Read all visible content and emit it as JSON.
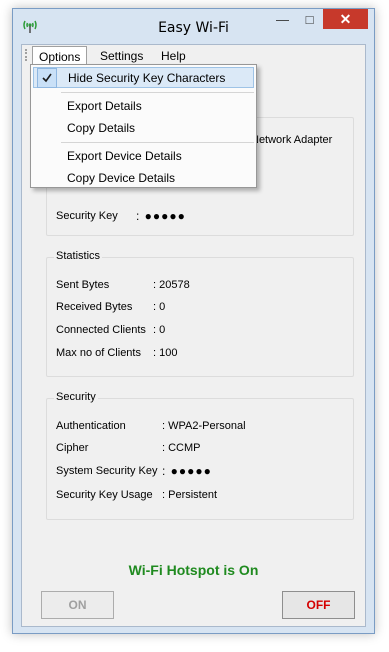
{
  "window": {
    "title": "Easy Wi-Fi"
  },
  "menubar": {
    "items": [
      "Options",
      "Settings",
      "Help"
    ]
  },
  "options_menu": {
    "items": [
      {
        "label": "Hide Security Key Characters",
        "checked": true
      },
      {
        "label": "Export Details"
      },
      {
        "label": "Copy Details"
      },
      {
        "label": "Export Device Details"
      },
      {
        "label": "Copy Device Details"
      }
    ]
  },
  "network": {
    "adapter_partial": "Network Adapter",
    "security_key_label": "Security Key",
    "security_key_value": ": ●●●●●"
  },
  "statistics": {
    "title": "Statistics",
    "rows": [
      {
        "label": "Sent Bytes",
        "value": ": 20578"
      },
      {
        "label": "Received Bytes",
        "value": ": 0"
      },
      {
        "label": "Connected Clients",
        "value": ": 0"
      },
      {
        "label": "Max no of Clients",
        "value": ": 100"
      }
    ]
  },
  "security": {
    "title": "Security",
    "rows": [
      {
        "label": "Authentication",
        "value": ": WPA2-Personal"
      },
      {
        "label": "Cipher",
        "value": ": CCMP"
      },
      {
        "label": "System Security Key",
        "value": ": ●●●●●"
      },
      {
        "label": "Security Key Usage",
        "value": ": Persistent"
      }
    ]
  },
  "status": {
    "text": "Wi-Fi Hotspot is On",
    "color": "#1f8a1f"
  },
  "buttons": {
    "on": "ON",
    "off": "OFF"
  }
}
